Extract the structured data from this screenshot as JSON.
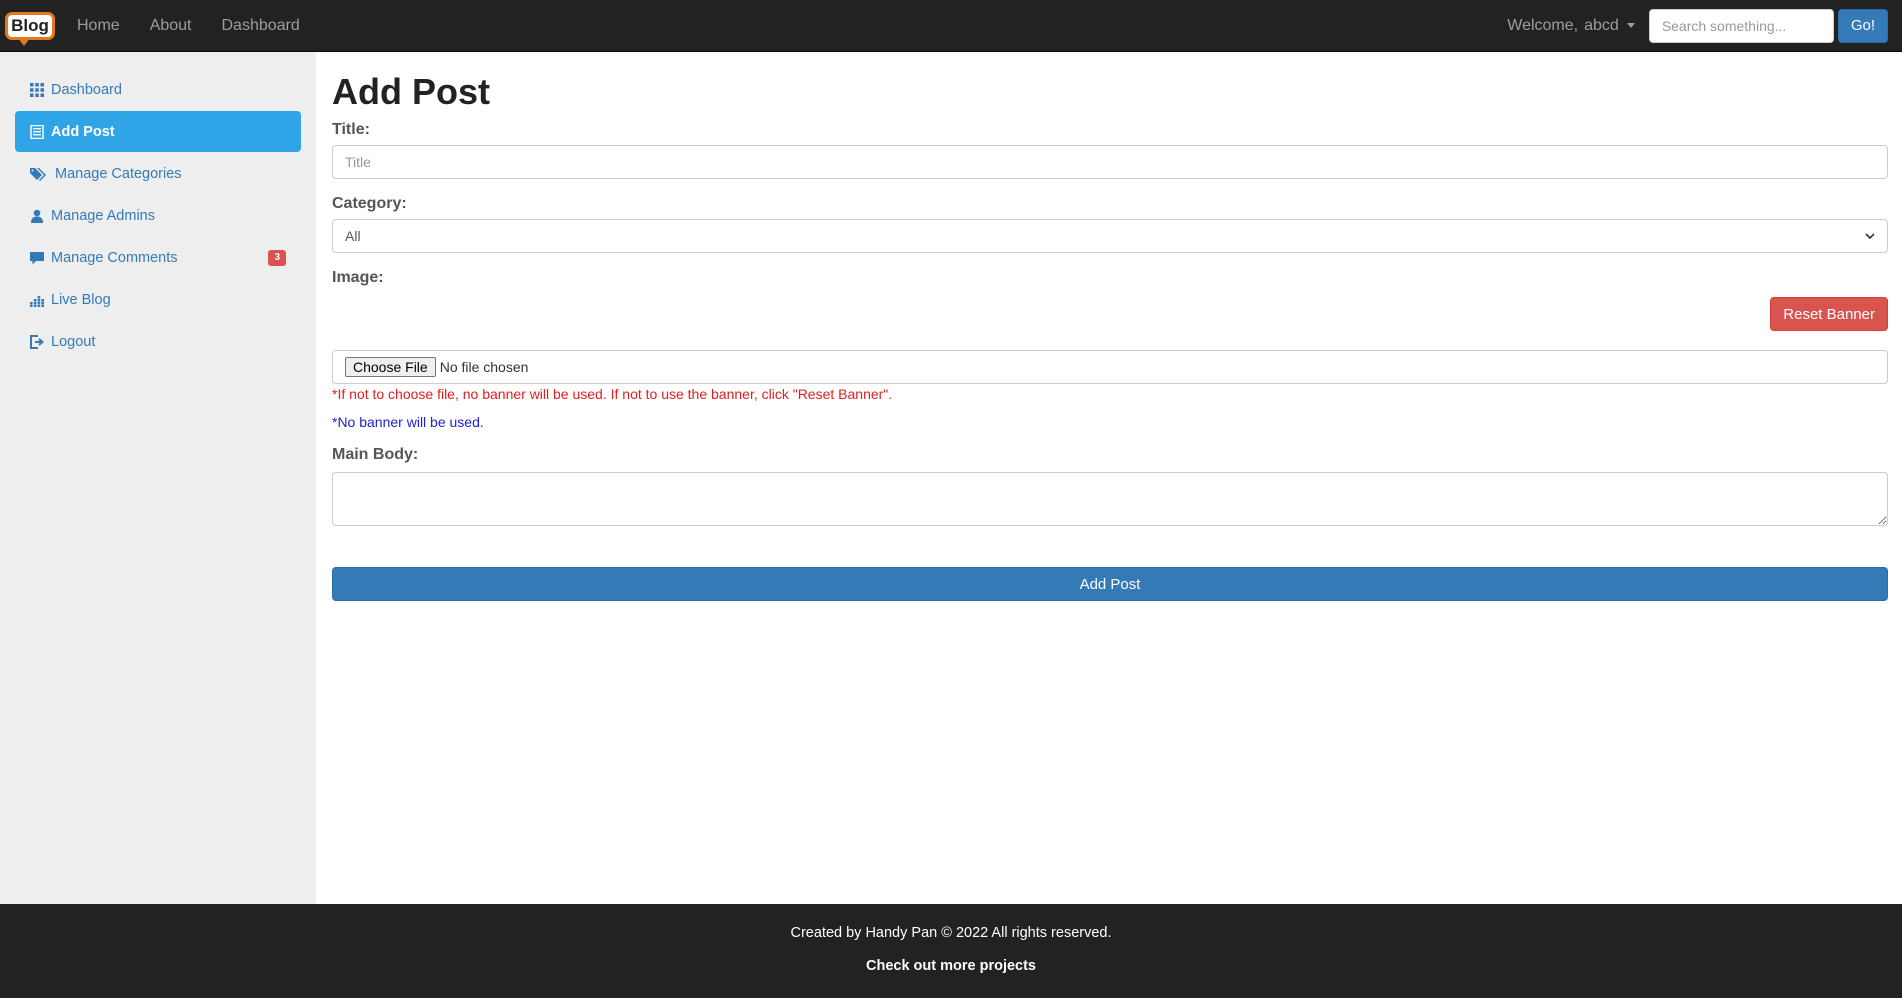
{
  "navbar": {
    "brand_text": "Blog",
    "links": [
      "Home",
      "About",
      "Dashboard"
    ],
    "welcome_label": "Welcome,",
    "username": "abcd",
    "search_placeholder": "Search something...",
    "go_label": "Go!"
  },
  "sidebar": {
    "items": [
      {
        "label": "Dashboard",
        "icon": "grid-icon"
      },
      {
        "label": "Add Post",
        "icon": "list-alt-icon",
        "active": true
      },
      {
        "label": "Manage Categories",
        "icon": "tags-icon"
      },
      {
        "label": "Manage Admins",
        "icon": "user-icon"
      },
      {
        "label": "Manage Comments",
        "icon": "comment-icon",
        "badge": "3"
      },
      {
        "label": "Live Blog",
        "icon": "equalizer-icon"
      },
      {
        "label": "Logout",
        "icon": "log-out-icon"
      }
    ]
  },
  "main": {
    "page_title": "Add Post",
    "title_label": "Title:",
    "title_placeholder": "Title",
    "category_label": "Category:",
    "category_value": "All",
    "image_label": "Image:",
    "reset_banner_label": "Reset Banner",
    "choose_file_label": "Choose File",
    "file_status": "No file chosen",
    "note_red": "*If not to choose file, no banner will be used. If not to use the banner, click \"Reset Banner\".",
    "note_blue": "*No banner will be used.",
    "body_label": "Main Body:",
    "submit_label": "Add Post"
  },
  "footer": {
    "line": "Created by Handy Pan © 2022 All rights reserved.",
    "link": "Check out more projects"
  },
  "colors": {
    "navbar_bg": "#222222",
    "sidebar_bg": "#eeeeee",
    "active_item": "#2fa4e7",
    "primary": "#337ab7",
    "danger": "#d9534f",
    "link": "#337ab7"
  }
}
